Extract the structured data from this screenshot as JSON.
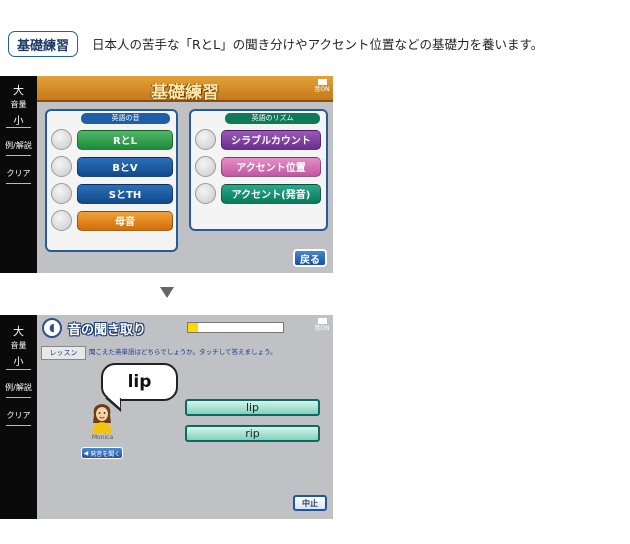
{
  "intro": {
    "badge": "基礎練習",
    "description": "日本人の苦手な「RとL」の聞き分けやアクセント位置などの基礎力を養います。"
  },
  "sidebar": {
    "large": "大",
    "volume": "音量",
    "small": "小",
    "example": "例/解説",
    "clear": "クリア"
  },
  "screen1": {
    "title": "基礎練習",
    "battery": "音ON",
    "left_panel": {
      "heading": "英語の音",
      "buttons": [
        "RとL",
        "BとV",
        "SとTH",
        "母音"
      ]
    },
    "right_panel": {
      "heading": "英語のリズム",
      "buttons": [
        "シラブルカウント",
        "アクセント位置",
        "アクセント(発音)"
      ]
    },
    "back": "戻る"
  },
  "screen2": {
    "title": "音の聞き取り",
    "battery": "音ON",
    "progress": 0.1,
    "tab": "レッスン",
    "instruction": "聞こえた英単語はどちらでしょうか。タッチして答えましょう。",
    "bubble": "lip",
    "speaker": "Monica",
    "play": "発音を聞く",
    "answers": [
      "lip",
      "rip"
    ],
    "stop": "中止"
  }
}
